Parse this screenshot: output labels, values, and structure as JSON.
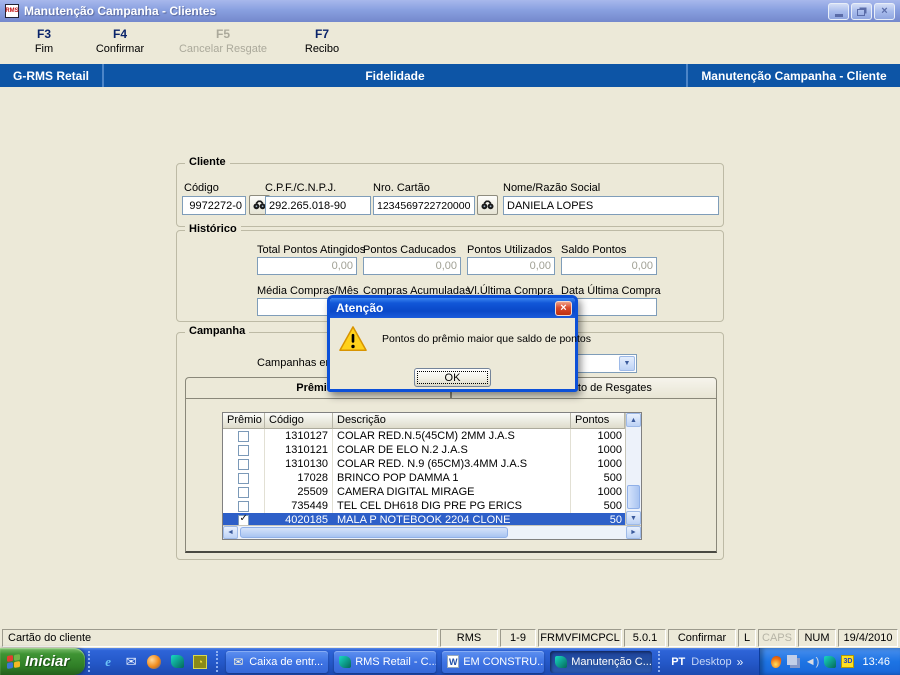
{
  "window": {
    "title": "Manutenção Campanha - Clientes",
    "app_icon": "RMS"
  },
  "icons": {
    "search": "binoculars",
    "warning": "exclamation-triangle",
    "close_x": "×",
    "combo_arrow": "▼",
    "scroll_up": "▲",
    "scroll_down": "▼",
    "scroll_left": "◄",
    "scroll_right": "►",
    "check": "✓",
    "chevron": "»"
  },
  "toolbar": {
    "items": [
      {
        "key": "F3",
        "label": "Fim"
      },
      {
        "key": "F4",
        "label": "Confirmar"
      },
      {
        "key": "F5",
        "label": "Cancelar Resgate",
        "disabled": true
      },
      {
        "key": "F7",
        "label": "Recibo"
      }
    ]
  },
  "header_band": {
    "left": "G-RMS Retail",
    "center": "Fidelidade",
    "right": "Manutenção Campanha - Cliente"
  },
  "cliente": {
    "title": "Cliente",
    "codigo_label": "Código",
    "codigo_value": "9972272-0",
    "cpf_label": "C.P.F./C.N.P.J.",
    "cpf_value": "292.265.018-90",
    "cartao_label": "Nro. Cartão",
    "cartao_value": "1234569722720000",
    "nome_label": "Nome/Razão Social",
    "nome_value": "DANIELA LOPES"
  },
  "historico": {
    "title": "Histórico",
    "row1": [
      {
        "label": "Total Pontos Atingidos",
        "value": "0,00"
      },
      {
        "label": "Pontos Caducados",
        "value": "0,00"
      },
      {
        "label": "Pontos Utilizados",
        "value": "0,00"
      },
      {
        "label": "Saldo Pontos",
        "value": "0,00"
      }
    ],
    "row2": [
      {
        "label": "Média Compras/Mês",
        "value": ""
      },
      {
        "label": "Compras Acumuladas",
        "value": ""
      },
      {
        "label": "Vl.Última Compra",
        "value": ""
      },
      {
        "label": "Data Última Compra",
        "value": ""
      }
    ]
  },
  "campanha": {
    "title": "Campanha",
    "combo_label": "Campanhas em",
    "combo_value": "",
    "tabs": [
      {
        "label": "Prêmios",
        "active": true
      },
      {
        "label": "Cancelamento de Resgates",
        "active": false
      }
    ]
  },
  "table": {
    "columns": {
      "premio": "Prêmio",
      "codigo": "Código",
      "descricao": "Descrição",
      "pontos": "Pontos"
    },
    "rows": [
      {
        "checked": false,
        "selected": false,
        "codigo": "1310127",
        "descricao": "COLAR RED.N.5(45CM) 2MM J.A.S",
        "pontos": "1000"
      },
      {
        "checked": false,
        "selected": false,
        "codigo": "1310121",
        "descricao": "COLAR DE ELO N.2 J.A.S",
        "pontos": "1000"
      },
      {
        "checked": false,
        "selected": false,
        "codigo": "1310130",
        "descricao": "COLAR RED. N.9 (65CM)3.4MM J.A.S",
        "pontos": "1000"
      },
      {
        "checked": false,
        "selected": false,
        "codigo": "17028",
        "descricao": "BRINCO POP DAMMA  1",
        "pontos": "500"
      },
      {
        "checked": false,
        "selected": false,
        "codigo": "25509",
        "descricao": "CAMERA DIGITAL MIRAGE",
        "pontos": "1000"
      },
      {
        "checked": false,
        "selected": false,
        "codigo": "735449",
        "descricao": "TEL CEL DH618 DIG PRE PG ERICS",
        "pontos": "500"
      },
      {
        "checked": true,
        "selected": true,
        "codigo": "4020185",
        "descricao": "MALA P NOTEBOOK 2204 CLONE",
        "pontos": "50"
      }
    ]
  },
  "dialog": {
    "title": "Atenção",
    "message": "Pontos do prêmio maior que saldo de pontos",
    "ok_label": "OK"
  },
  "statusbar": {
    "message": "Cartão do cliente",
    "segments": [
      {
        "label": "RMS"
      },
      {
        "label": "1-9"
      },
      {
        "label": "FRMVFIMCPCL"
      },
      {
        "label": "5.0.1"
      },
      {
        "label": "Confirmar"
      },
      {
        "label": "L"
      },
      {
        "label": "CAPS",
        "dim": true
      },
      {
        "label": "NUM"
      },
      {
        "label": "19/4/2010"
      }
    ]
  },
  "taskbar": {
    "start_label": "Iniciar",
    "tasks": [
      {
        "label": "Caixa de entr...",
        "icon": "mail",
        "active": false
      },
      {
        "label": "RMS Retail - C...",
        "icon": "rms",
        "active": false
      },
      {
        "label": "EM CONSTRU...",
        "icon": "word",
        "active": false
      },
      {
        "label": "Manutenção C...",
        "icon": "rms",
        "active": true
      }
    ],
    "language": "PT",
    "desktop_label": "Desktop",
    "clock": "13:46"
  },
  "colors": {
    "header_blue": "#0D55A6",
    "selection_blue": "#2D5FC8",
    "xp_tan": "#ECE9D8",
    "warning_yellow": "#FFD21C",
    "start_green": "#3F9434"
  }
}
